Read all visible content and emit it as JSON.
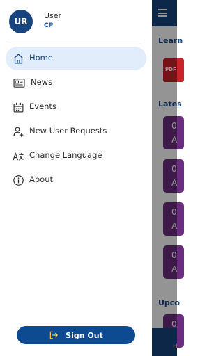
{
  "background": {
    "sections": [
      "Learn",
      "Lates",
      "Upco"
    ],
    "pdf_label": "PDF",
    "cards": [
      {
        "day": "0",
        "letter": "A"
      },
      {
        "day": "0",
        "letter": "A"
      },
      {
        "day": "0",
        "letter": "A"
      },
      {
        "day": "0",
        "letter": "A"
      }
    ],
    "bottom_letter": "H"
  },
  "user": {
    "initials": "UR",
    "name": "User",
    "role": "CP"
  },
  "nav": {
    "items": [
      {
        "label": "Home",
        "icon": "home-icon"
      },
      {
        "label": "News",
        "icon": "newspaper-icon"
      },
      {
        "label": "Events",
        "icon": "calendar-icon"
      },
      {
        "label": "New User Requests",
        "icon": "user-add-icon"
      },
      {
        "label": "Change Language",
        "icon": "translate-icon"
      },
      {
        "label": "About",
        "icon": "info-icon"
      }
    ]
  },
  "signout": {
    "label": "Sign Out",
    "icon": "sign-out-icon"
  },
  "colors": {
    "primary": "#17447f",
    "active_bg": "#e1edfb",
    "accent": "#f4d03f",
    "card": "#6b2d80"
  }
}
